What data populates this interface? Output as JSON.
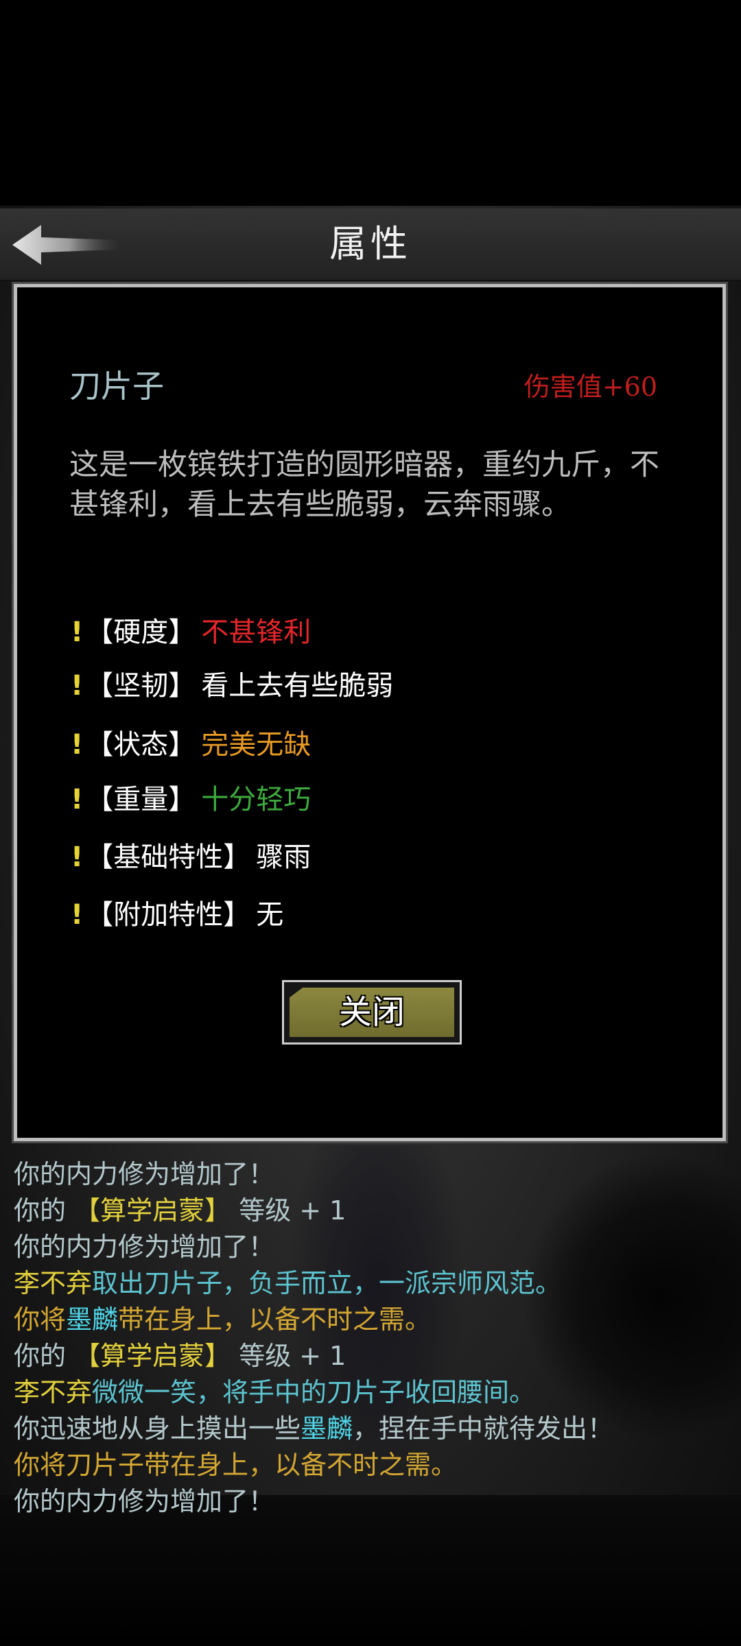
{
  "header": {
    "title": "属性",
    "back_icon": "back-arrow-icon"
  },
  "item": {
    "name": "刀片子",
    "stat": "伤害值+60",
    "description": "这是一枚镔铁打造的圆形暗器，重约九斤，不甚锋利，看上去有些脆弱，云奔雨骤。",
    "properties": [
      {
        "mark": "!",
        "label": "【硬度】",
        "value": "不甚锋利",
        "color": "#e5262a"
      },
      {
        "mark": "!",
        "label": "【坚韧】",
        "value": "看上去有些脆弱",
        "color": "#ffffff"
      },
      {
        "mark": "!",
        "label": "【状态】",
        "value": "完美无缺",
        "color": "#e79a23"
      },
      {
        "mark": "!",
        "label": "【重量】",
        "value": "十分轻巧",
        "color": "#3eaa3e"
      },
      {
        "mark": "!",
        "label": "【基础特性】",
        "value": "骤雨",
        "color": "#ffffff"
      },
      {
        "mark": "!",
        "label": "【附加特性】",
        "value": "无",
        "color": "#ffffff"
      }
    ],
    "close_label": "关闭"
  },
  "log": [
    [
      {
        "t": "你的内力修为增加了！",
        "c": "gray"
      }
    ],
    [
      {
        "t": "你的 ",
        "c": "gray"
      },
      {
        "t": "【算学启蒙】",
        "c": "yellow"
      },
      {
        "t": " 等级 + 1",
        "c": "gray"
      }
    ],
    [
      {
        "t": "你的内力修为增加了！",
        "c": "gray"
      }
    ],
    [
      {
        "t": "李不弃",
        "c": "yellow"
      },
      {
        "t": "取出刀片子，负手而立，一派宗师风范。",
        "c": "teal"
      }
    ],
    [
      {
        "t": "你将",
        "c": "gold"
      },
      {
        "t": "墨麟",
        "c": "cyan"
      },
      {
        "t": "带在身上，以备不时之需。",
        "c": "gold"
      }
    ],
    [
      {
        "t": "你的 ",
        "c": "gray"
      },
      {
        "t": "【算学启蒙】",
        "c": "yellow"
      },
      {
        "t": " 等级 + 1",
        "c": "gray"
      }
    ],
    [
      {
        "t": "李不弃",
        "c": "yellow"
      },
      {
        "t": "微微一笑，将手中的刀片子收回腰间。",
        "c": "teal"
      }
    ],
    [
      {
        "t": "你迅速地从身上摸出一些",
        "c": "gray"
      },
      {
        "t": "墨麟",
        "c": "cyan"
      },
      {
        "t": "，捏在手中就待发出！",
        "c": "gray"
      }
    ],
    [
      {
        "t": "你将刀片子带在身上，以备不时之需。",
        "c": "gold"
      }
    ],
    [
      {
        "t": "你的内力修为增加了！",
        "c": "gray"
      }
    ]
  ]
}
